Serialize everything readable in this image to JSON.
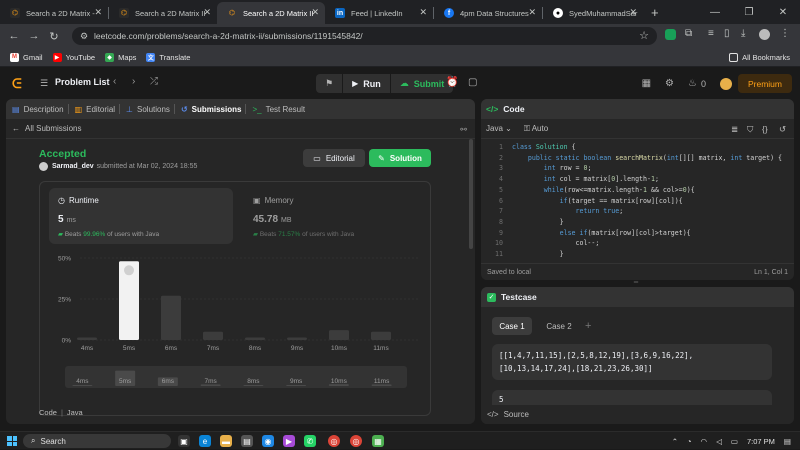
{
  "browser": {
    "tabs": [
      {
        "title": "Search a 2D Matrix -",
        "active": false
      },
      {
        "title": "Search a 2D Matrix II",
        "active": false
      },
      {
        "title": "Search a 2D Matrix II",
        "active": true
      },
      {
        "title": "Feed | LinkedIn",
        "active": false
      },
      {
        "title": "4pm Data Structures",
        "active": false
      },
      {
        "title": "SyedMuhammadSar",
        "active": false
      }
    ],
    "url": "leetcode.com/problems/search-a-2d-matrix-ii/submissions/1191545842/",
    "bookmarks": [
      "Gmail",
      "YouTube",
      "Maps",
      "Translate"
    ],
    "all_bookmarks": "All Bookmarks"
  },
  "lc_nav": {
    "problem_list": "Problem List",
    "run": "Run",
    "submit": "Submit",
    "streak": "0",
    "premium": "Premium"
  },
  "left": {
    "tabs": [
      "Description",
      "Editorial",
      "Solutions",
      "Submissions",
      "Test Result"
    ],
    "all_submissions": "All Submissions",
    "status": "Accepted",
    "user": "Sarmad_dev",
    "submitted_at": "submitted at Mar 02, 2024 18:55",
    "editorial_btn": "Editorial",
    "solution_btn": "Solution",
    "runtime": {
      "label": "Runtime",
      "value": "5",
      "unit": "ms",
      "beats_pre": "Beats",
      "beats": "99.96%",
      "beats_post": "of users with Java"
    },
    "memory": {
      "label": "Memory",
      "value": "45.78",
      "unit": "MB",
      "beats_pre": "Beats",
      "beats": "71.57%",
      "beats_post": "of users with Java"
    },
    "code_label": "Code",
    "code_lang": "Java"
  },
  "chart_data": {
    "type": "bar",
    "categories": [
      "4ms",
      "5ms",
      "6ms",
      "7ms",
      "8ms",
      "9ms",
      "10ms",
      "11ms"
    ],
    "values": [
      1.5,
      48,
      27,
      5,
      1.5,
      1.5,
      6,
      5
    ],
    "yticks": [
      "50%",
      "25%",
      "0%"
    ],
    "ylim": [
      0,
      50
    ],
    "highlight": "5ms"
  },
  "editor": {
    "title": "Code",
    "lang": "Java",
    "auto": "Auto",
    "lines": [
      "class Solution {",
      "    public static boolean searchMatrix(int[][] matrix, int target) {",
      "        int row = 0;",
      "        int col = matrix[0].length-1;",
      "        while(row<=matrix.length-1 && col>=0){",
      "            if(target == matrix[row][col]){",
      "                return true;",
      "            }",
      "            else if(matrix[row][col]>target){",
      "                col--;",
      "            }"
    ],
    "saved": "Saved to local",
    "cursor": "Ln 1, Col 1"
  },
  "testcase": {
    "title": "Testcase",
    "cases": [
      "Case 1",
      "Case 2"
    ],
    "input_line1": "[[1,4,7,11,15],[2,5,8,12,19],[3,6,9,16,22],",
    "input_line2": "[10,13,14,17,24],[18,21,23,26,30]]",
    "target": "5",
    "source": "Source"
  },
  "taskbar": {
    "search": "Search",
    "time": "7:07 PM"
  },
  "colors": {
    "accent": "#ffa116",
    "green": "#2cbb5d",
    "bar": "#3c3c3c",
    "bar_highlight": "#f2f2f2"
  }
}
